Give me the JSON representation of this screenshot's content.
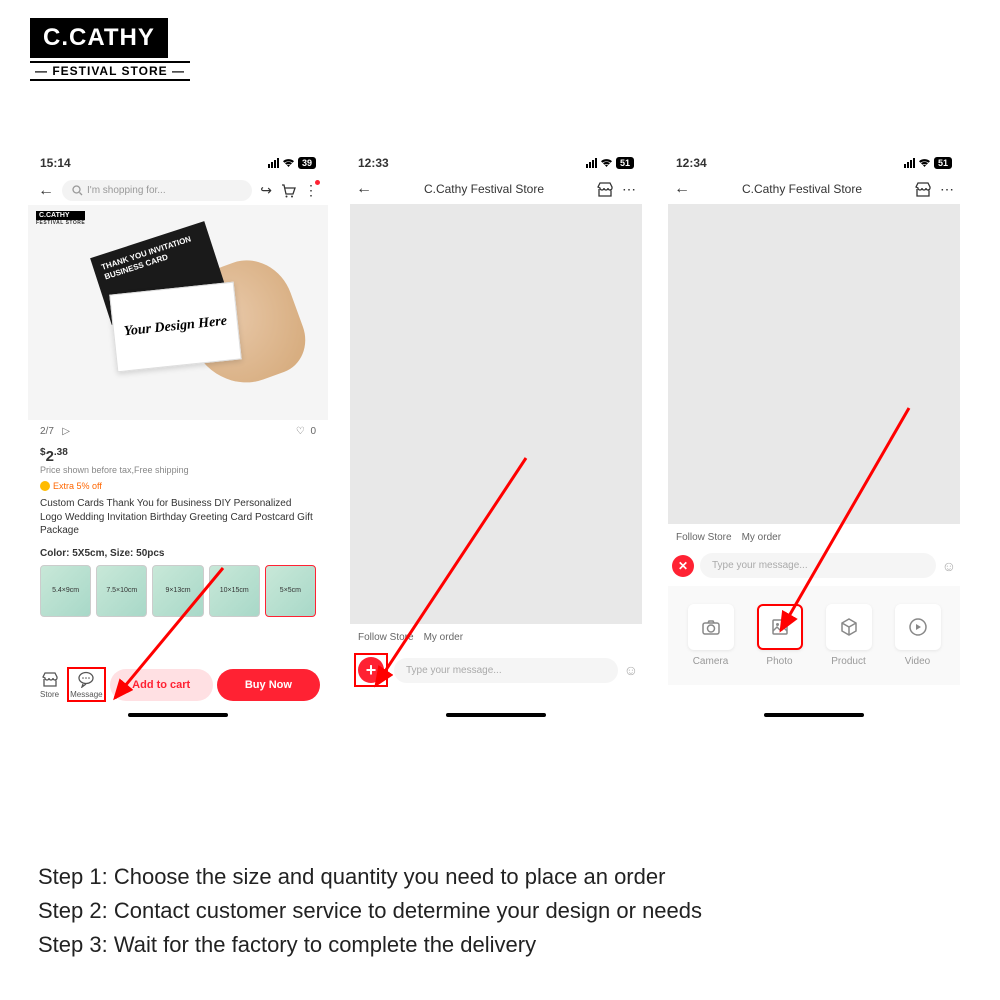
{
  "logo": {
    "main": "C.CATHY",
    "sub": "FESTIVAL STORE"
  },
  "p1": {
    "time": "15:14",
    "batt": "39",
    "search": "I'm shopping for...",
    "imgidx": "2/7",
    "likes": "0",
    "price_sym": "$",
    "price_int": "2",
    "price_dec": ".38",
    "subprice": "Price shown before tax,Free shipping",
    "badge": "Extra 5% off",
    "title": "Custom Cards Thank You for Business DIY Personalized Logo Wedding Invitation Birthday Greeting Card Postcard Gift Package",
    "colorline": "Color: 5X5cm, Size: 50pcs",
    "swatches": [
      "5.4×9cm",
      "7.5×10cm",
      "9×13cm",
      "10×15cm",
      "5×5cm"
    ],
    "darkcard": "THANK YOU INVITATION BUSINESS CARD",
    "whitecard": "Your Design Here",
    "store": "Store",
    "message": "Message",
    "addcart": "Add to cart",
    "buynow": "Buy Now"
  },
  "p2": {
    "time": "12:33",
    "batt": "51",
    "title": "C.Cathy Festival Store",
    "tab1": "Follow Store",
    "tab2": "My order",
    "msg": "Type your message..."
  },
  "p3": {
    "time": "12:34",
    "batt": "51",
    "title": "C.Cathy Festival Store",
    "tab1": "Follow Store",
    "tab2": "My order",
    "msg": "Type your message...",
    "att": [
      "Camera",
      "Photo",
      "Product",
      "Video"
    ]
  },
  "steps": {
    "s1": "Step 1: Choose the size and quantity you need to place an order",
    "s2": "Step 2: Contact customer service to determine your design or needs",
    "s3": "Step 3: Wait for the factory to complete the delivery"
  }
}
